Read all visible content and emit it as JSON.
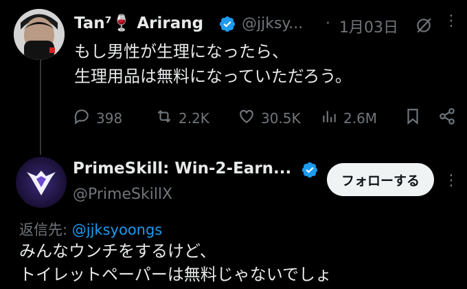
{
  "tweet": {
    "display_name": "Tan⁷🍷 Arirang",
    "handle": "@jjksy...",
    "separator": "·",
    "date": "1月03日",
    "text_line1": "もし男性が生理になったら、",
    "text_line2": "生理用品は無料になっていただろう。",
    "replies": "398",
    "retweets": "2.2K",
    "likes": "30.5K",
    "views": "2.6M"
  },
  "reply": {
    "display_name": "PrimeSkill: Win-2-Earn...",
    "handle": "@PrimeSkillX",
    "follow_label": "フォローする",
    "reply_to_prefix": "返信先:",
    "reply_to_handle": "@jjksyoongs",
    "text_line1": "みんなウンチをするけど、",
    "text_line2": "トイレットペーパーは無料じゃないでしょ"
  },
  "colors": {
    "background": "#000000",
    "text": "#e7e9ea",
    "muted": "#71767b",
    "verified": "#1d9bf0",
    "link": "#1d9bf0"
  },
  "icons": [
    "reply-icon",
    "retweet-icon",
    "like-icon",
    "views-icon",
    "bookmark-icon",
    "share-icon",
    "more-icon",
    "verified-icon",
    "grok-icon"
  ]
}
